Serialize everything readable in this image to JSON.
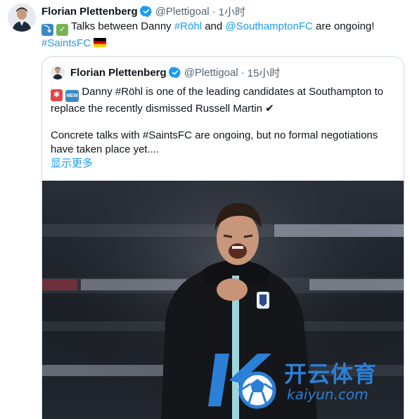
{
  "tweet": {
    "author_name": "Florian Plettenberg",
    "handle": "@Plettigoal",
    "separator": "·",
    "time": "1小时",
    "text_prefix": "Talks between Danny ",
    "hashtag_rohl": "#Röhl",
    "text_and": " and ",
    "mention_saints": "@SouthamptonFC",
    "text_suffix": " are ongoing!",
    "hashtag_saints": "#SaintsFC"
  },
  "quote": {
    "author_name": "Florian Plettenberg",
    "handle": "@Plettigoal",
    "separator": "·",
    "time": "15小时",
    "new_badge": "NEW",
    "paragraph_1": "Danny #Röhl is one of the leading candidates at Southampton to replace the recently dismissed Russell Martin ✔",
    "paragraph_2": "Concrete talks with #SaintsFC are ongoing, but no formal negotiations have taken place yet....",
    "show_more": "显示更多"
  },
  "watermark": {
    "brand_cn": "开云体育",
    "brand_url": "kaiyun.com"
  },
  "colors": {
    "link": "#1d9bf0",
    "verified": "#1d9bf0",
    "secondary_text": "#536471",
    "border": "#cfd9de",
    "watermark": "#2b7fd6"
  }
}
